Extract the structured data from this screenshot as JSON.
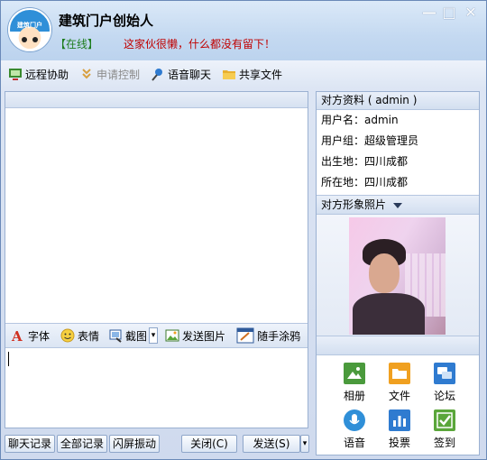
{
  "header": {
    "title": "建筑门户创始人",
    "status": "【在线】",
    "signature": "这家伙很懒，什么都没有留下！",
    "avatar_text": "建筑门户"
  },
  "window_controls": {
    "minimize": "—",
    "maximize": "□",
    "close": "✕"
  },
  "toolbar": {
    "items": [
      {
        "label": "远程协助",
        "icon": "remote-assist-icon",
        "enabled": true
      },
      {
        "label": "申请控制",
        "icon": "request-control-icon",
        "enabled": false
      },
      {
        "label": "语音聊天",
        "icon": "voice-chat-icon",
        "enabled": true
      },
      {
        "label": "共享文件",
        "icon": "folder-icon",
        "enabled": true
      }
    ]
  },
  "chat_toolbar": {
    "font": "字体",
    "emoji": "表情",
    "screenshot": "截图",
    "send_image": "发送图片",
    "doodle": "随手涂鸦"
  },
  "bottom_bar": {
    "chat_history": "聊天记录",
    "all_history": "全部记录",
    "shake": "闪屏振动",
    "close": "关闭(C)",
    "send": "发送(S)"
  },
  "profile": {
    "heading": "对方资料 ( admin )",
    "username": "用户名：admin",
    "group": "用户组：超级管理员",
    "birthplace": "出生地：四川成都",
    "location": "所在地：四川成都",
    "photo_heading": "对方形象照片"
  },
  "apps": [
    {
      "label": "相册",
      "icon": "photo-album-icon",
      "color": "#4a9a3c"
    },
    {
      "label": "文件",
      "icon": "folder-icon",
      "color": "#f0a020"
    },
    {
      "label": "论坛",
      "icon": "forum-icon",
      "color": "#2f7bd0"
    },
    {
      "label": "语音",
      "icon": "voice-icon",
      "color": "#2f8fd8"
    },
    {
      "label": "投票",
      "icon": "vote-icon",
      "color": "#2f7bd0"
    },
    {
      "label": "签到",
      "icon": "check-in-icon",
      "color": "#5aa63a"
    }
  ]
}
